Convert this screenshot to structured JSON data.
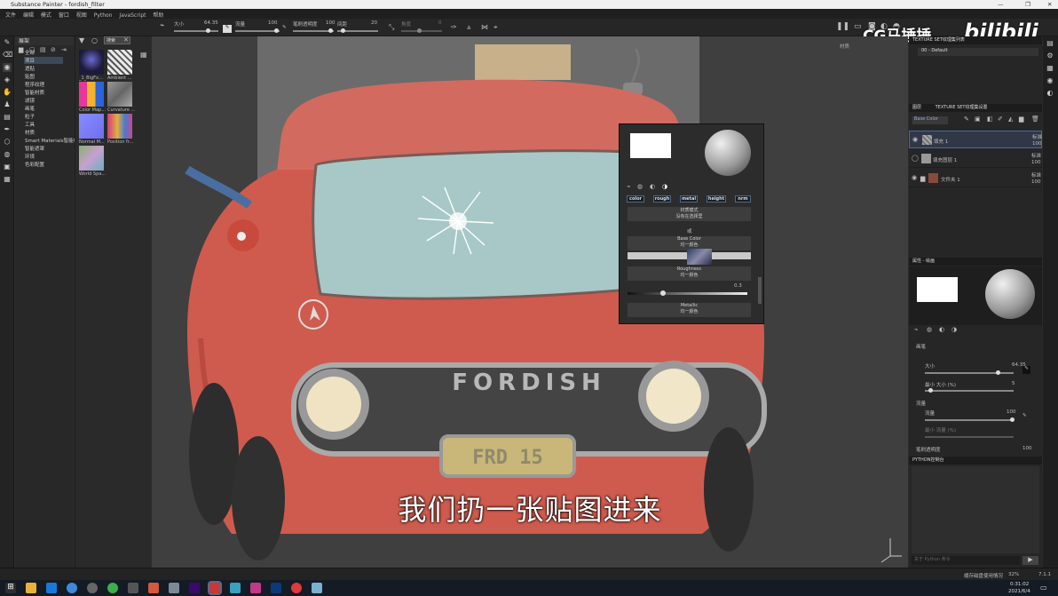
{
  "window": {
    "title": "Substance Painter - fordish_filter"
  },
  "menu": [
    "文件",
    "编辑",
    "模式",
    "窗口",
    "视图",
    "Python",
    "JavaScript",
    "帮助"
  ],
  "toolbar": {
    "size_label": "大小",
    "size_value": "64.35",
    "flow_label": "流量",
    "flow_value": "100",
    "stroke_opacity_label": "笔刷透明度",
    "stroke_opacity_value": "100",
    "spacing_label": "间距",
    "spacing_value": "20",
    "angle_label": "角度",
    "angle_value": "0"
  },
  "shelf": {
    "tab_label": "展架",
    "search_value": "搜索",
    "categories": [
      "全部",
      "项目",
      "透贴",
      "贴图",
      "程序纹理",
      "智能材质",
      "滤镜",
      "画笔",
      "粒子",
      "工具",
      "材质",
      "Smart Materials智能材",
      "智能遮罩",
      "环境",
      "色彩配置"
    ],
    "selected_index": 1,
    "thumbs": [
      {
        "label": "_1_BigFx...",
        "color": "#1d1a3a"
      },
      {
        "label": "Ambient ...",
        "color": "#dcdcdc"
      },
      {
        "label": "Color Map...",
        "color": "#d93a6a"
      },
      {
        "label": "Curvature ...",
        "color": "#8a8a8a"
      },
      {
        "label": "Normal M...",
        "color": "#7b7ef0"
      },
      {
        "label": "Position fr...",
        "color": "#c84a8a"
      },
      {
        "label": "World Spa...",
        "color": "#8ab070"
      }
    ]
  },
  "viewport": {
    "subtitle": "我们扔一张贴图进来",
    "plate_text": "FRD 15",
    "grille_text": "FORDISH"
  },
  "popup": {
    "chips": [
      "color",
      "rough",
      "metal",
      "height",
      "nrm"
    ],
    "material_mode_label": "材质模式",
    "material_mode_value": "没有在选择里",
    "base_color_label": "Base Color",
    "base_color_value": "均一颜色",
    "roughness_label": "Roughness",
    "roughness_value": "均一颜色",
    "roughness_number": "0.3",
    "metallic_label": "Metallic",
    "metallic_value": "均一颜色",
    "section_label": "或"
  },
  "texture_set": {
    "header": "TEXTURE SET纹理集列表",
    "shader_label": "材质",
    "shader_value": "00 - Default"
  },
  "layers": {
    "tab1": "图层",
    "tab2": "TEXTURE SET纹理集设置",
    "channel_value": "Base Color",
    "items": [
      {
        "name": "填充 1",
        "blend": "标准",
        "opacity": "100"
      },
      {
        "name": "填充图层 1",
        "blend": "标准",
        "opacity": "100"
      },
      {
        "name": "文件夹 1",
        "blend": "标准",
        "opacity": "100"
      }
    ]
  },
  "properties": {
    "header": "属性 - 绘画",
    "section_brush": "画笔",
    "size_label": "大小",
    "size_value": "64.35",
    "min_size_label": "最小 大小 (%)",
    "min_size_value": "5",
    "flow_section": "流量",
    "flow_label": "流量",
    "flow_value": "100",
    "min_flow_label": "最小 流量 (%)",
    "opacity_label": "笔刷透明度",
    "opacity_value": "100"
  },
  "python": {
    "header": "PYTHON控制台",
    "input_placeholder": "关于 Python 命令"
  },
  "status": {
    "right_text": "缓存磁盘使用情况",
    "percent": "32%",
    "version": "7.1.1",
    "time": "0:31:02",
    "date": "2021/6/4"
  },
  "watermark": {
    "text": "CG马捶捶",
    "brand": "bilibili"
  }
}
